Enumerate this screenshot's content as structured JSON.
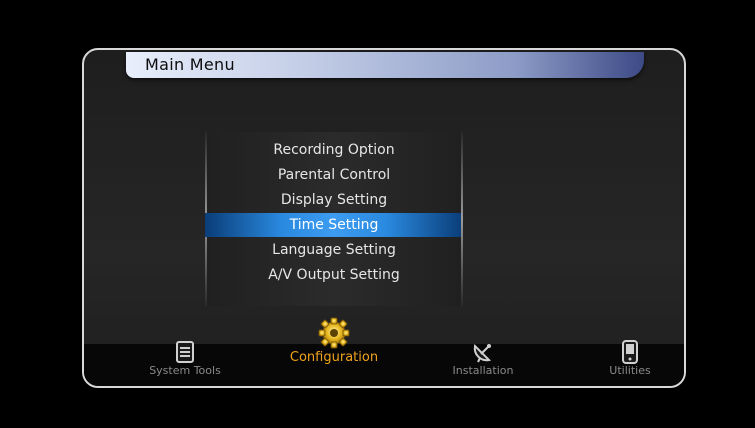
{
  "header": {
    "title": "Main Menu"
  },
  "menu": {
    "items": [
      {
        "label": "Recording Option"
      },
      {
        "label": "Parental Control"
      },
      {
        "label": "Display Setting"
      },
      {
        "label": "Time Setting"
      },
      {
        "label": "Language Setting"
      },
      {
        "label": "A/V Output Setting"
      }
    ],
    "selected": "Time Setting"
  },
  "bottom_nav": {
    "items": [
      {
        "label": "System Tools",
        "icon": "system-tools-icon"
      },
      {
        "label": "Configuration",
        "icon": "gear-icon",
        "active": true
      },
      {
        "label": "Installation",
        "icon": "satellite-dish-icon"
      },
      {
        "label": "Utilities",
        "icon": "handheld-device-icon"
      }
    ]
  },
  "colors": {
    "accent": "#f0a21c",
    "selection": "#3d9cf0",
    "title_bar": "#c3cde6"
  }
}
